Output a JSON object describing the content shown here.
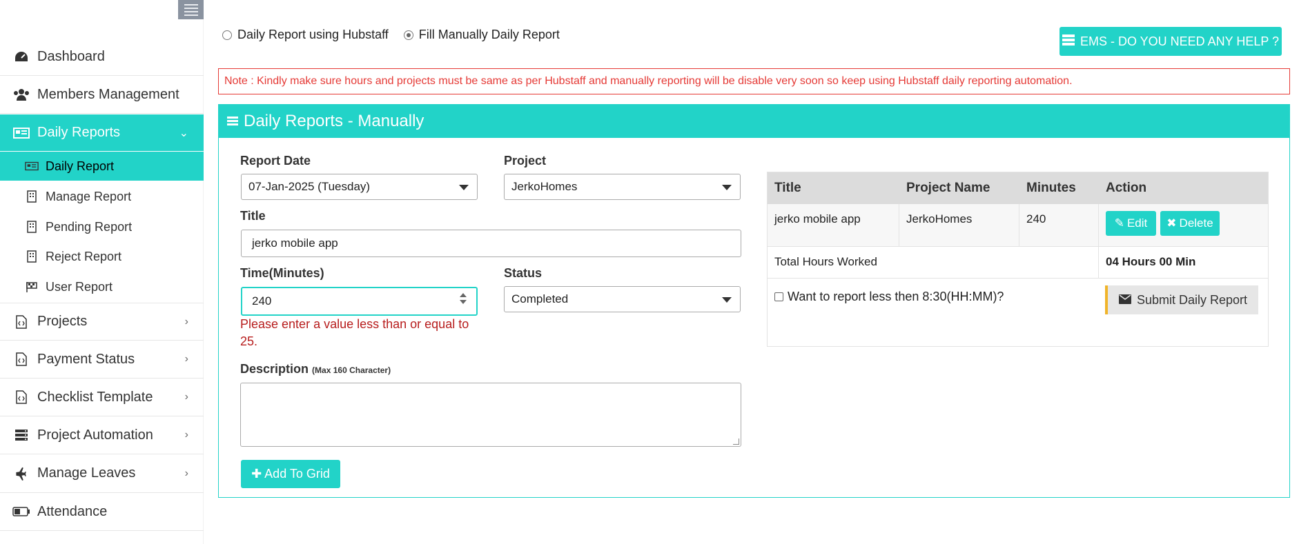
{
  "sidebar": {
    "items": [
      {
        "label": "Dashboard",
        "icon": "dashboard-icon"
      },
      {
        "label": "Members Management",
        "icon": "users-icon"
      },
      {
        "label": "Daily Reports",
        "icon": "newspaper-icon",
        "active": true
      },
      {
        "label": "Projects",
        "icon": "code-file-icon"
      },
      {
        "label": "Payment Status",
        "icon": "code-file-icon"
      },
      {
        "label": "Checklist Template",
        "icon": "code-file-icon"
      },
      {
        "label": "Project Automation",
        "icon": "server-icon"
      },
      {
        "label": "Manage Leaves",
        "icon": "plane-icon"
      },
      {
        "label": "Attendance",
        "icon": "battery-icon"
      }
    ],
    "daily_reports_sub": [
      {
        "label": "Daily Report",
        "icon": "newspaper-icon",
        "active": true
      },
      {
        "label": "Manage Report",
        "icon": "building-icon"
      },
      {
        "label": "Pending Report",
        "icon": "building-icon"
      },
      {
        "label": "Reject Report",
        "icon": "building-icon"
      },
      {
        "label": "User Report",
        "icon": "flag-checkered-icon"
      }
    ]
  },
  "mode": {
    "option1": "Daily Report using Hubstaff",
    "option2": "Fill Manually Daily Report",
    "selected": "option2"
  },
  "help_button": "EMS - DO YOU NEED ANY HELP ?",
  "note": "Note : Kindly make sure hours and projects must be same as per Hubstaff and manually reporting will be disable very soon so keep using Hubstaff daily reporting automation.",
  "panel": {
    "title": "Daily Reports - Manually"
  },
  "form": {
    "report_date_label": "Report Date",
    "report_date_value": "07-Jan-2025 (Tuesday)",
    "project_label": "Project",
    "project_value": "JerkoHomes",
    "title_label": "Title",
    "title_value": "jerko mobile app",
    "time_label": "Time(Minutes)",
    "time_value": "240",
    "status_label": "Status",
    "status_value": "Completed",
    "error": "Please enter a value less than or equal to 25.",
    "description_label": "Description",
    "description_hint": "(Max 160 Character)",
    "add_button": "Add To Grid"
  },
  "table": {
    "headers": [
      "Title",
      "Project Name",
      "Minutes",
      "Action"
    ],
    "rows": [
      {
        "title": "jerko mobile app",
        "project": "JerkoHomes",
        "minutes": "240"
      }
    ],
    "edit_label": "Edit",
    "delete_label": "Delete",
    "total_label": "Total Hours Worked",
    "total_value": "04 Hours 00 Min",
    "checkbox_label": "Want to report less then 8:30(HH:MM)?",
    "submit_label": "Submit Daily Report"
  },
  "colors": {
    "accent": "#22d3c8",
    "error": "#e53935",
    "submit_border": "#f0b429"
  }
}
